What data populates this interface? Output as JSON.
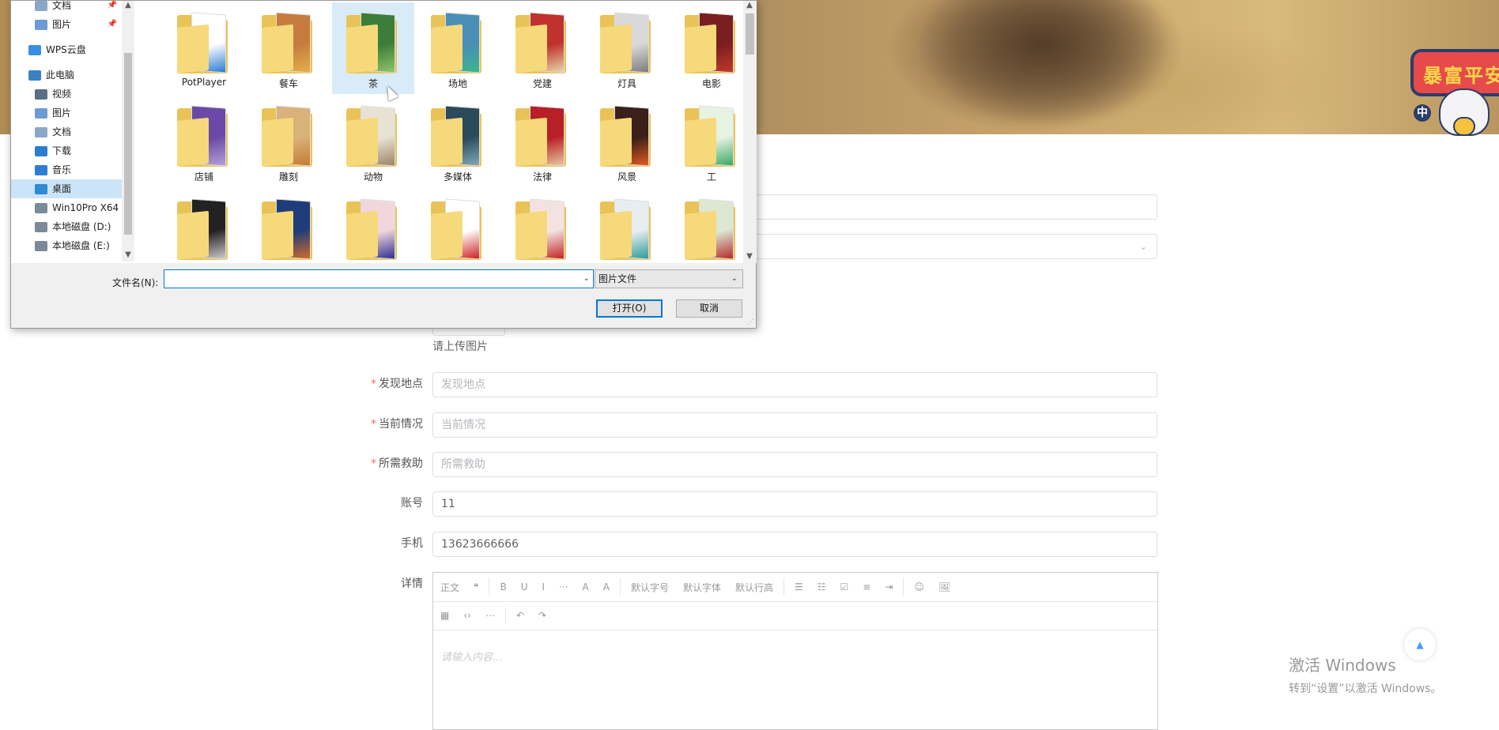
{
  "form": {
    "upload_hint": "请上传图片",
    "location": {
      "label": "发现地点",
      "placeholder": "发现地点"
    },
    "situation": {
      "label": "当前情况",
      "placeholder": "当前情况"
    },
    "help_needed": {
      "label": "所需救助",
      "placeholder": "所需救助"
    },
    "account": {
      "label": "账号",
      "value": "11"
    },
    "phone": {
      "label": "手机",
      "value": "13623666666"
    },
    "detail": {
      "label": "详情"
    },
    "required_mark": "*"
  },
  "banner": {
    "badge_text": "暴富平安",
    "badge_small": "中"
  },
  "editor": {
    "toolbar_row1": [
      "正文",
      "❝",
      "B",
      "U",
      "I",
      "···",
      "A",
      "A",
      "默认字号",
      "默认字体",
      "默认行高",
      "☰",
      "☷",
      "☑",
      "≡",
      "⇥",
      "☺",
      "🖼"
    ],
    "toolbar_row2": [
      "▦",
      "‹›",
      "⋯",
      "↶",
      "↷"
    ],
    "placeholder": "请输入内容..."
  },
  "back_to_top": "▲",
  "watermark": {
    "line1": "激活 Windows",
    "line2": "转到“设置”以激活 Windows。"
  },
  "dialog": {
    "nav_items": [
      {
        "label": "文档",
        "pinned": true,
        "icon": "document-icon",
        "color": "#8aa7c8"
      },
      {
        "label": "图片",
        "pinned": true,
        "icon": "picture-icon",
        "color": "#6e9bd1"
      },
      {
        "label": "WPS云盘",
        "pinned": false,
        "icon": "cloud-icon",
        "color": "#3a8ee6"
      },
      {
        "label": "此电脑",
        "pinned": false,
        "icon": "computer-icon",
        "color": "#3b82c4"
      },
      {
        "label": "视频",
        "pinned": false,
        "icon": "video-icon",
        "color": "#5a6e86"
      },
      {
        "label": "图片",
        "pinned": false,
        "icon": "picture-icon",
        "color": "#6e9bd1"
      },
      {
        "label": "文档",
        "pinned": false,
        "icon": "document-icon",
        "color": "#8aa7c8"
      },
      {
        "label": "下载",
        "pinned": false,
        "icon": "download-icon",
        "color": "#2d7dd2"
      },
      {
        "label": "音乐",
        "pinned": false,
        "icon": "music-icon",
        "color": "#2d7dd2"
      },
      {
        "label": "桌面",
        "pinned": false,
        "icon": "desktop-icon",
        "color": "#2e8bd6",
        "selected": true
      },
      {
        "label": "Win10Pro X64",
        "pinned": false,
        "icon": "drive-icon",
        "color": "#7a8a99"
      },
      {
        "label": "本地磁盘 (D:)",
        "pinned": false,
        "icon": "drive-icon",
        "color": "#7a8a99"
      },
      {
        "label": "本地磁盘 (E:)",
        "pinned": false,
        "icon": "drive-icon",
        "color": "#7a8a99"
      }
    ],
    "folders": [
      {
        "label": "PotPlayer",
        "paper": "#ffffff",
        "accent": "#2a7ad3"
      },
      {
        "label": "餐车",
        "paper": "#c77b3f",
        "accent": "#e3b04b"
      },
      {
        "label": "茶",
        "paper": "#3c7d3a",
        "accent": "#8fc46b",
        "selected": true
      },
      {
        "label": "场地",
        "paper": "#4a8fb6",
        "accent": "#3bb58c"
      },
      {
        "label": "党建",
        "paper": "#c0322d",
        "accent": "#e8d6a8"
      },
      {
        "label": "灯具",
        "paper": "#d9d9d9",
        "accent": "#7b7b7b"
      },
      {
        "label": "电影",
        "paper": "#7a1f1f",
        "accent": "#c0392b"
      },
      {
        "label": "店铺",
        "paper": "#6a4aa6",
        "accent": "#b4a0d8"
      },
      {
        "label": "雕刻",
        "paper": "#d9b27a",
        "accent": "#c57a33"
      },
      {
        "label": "动物",
        "paper": "#e8e2d4",
        "accent": "#9b8466"
      },
      {
        "label": "多媒体",
        "paper": "#2b4a5a",
        "accent": "#7fa9b8"
      },
      {
        "label": "法律",
        "paper": "#b81f26",
        "accent": "#e8c9a0"
      },
      {
        "label": "风景",
        "paper": "#3a1f1a",
        "accent": "#e35a22"
      },
      {
        "label": "工",
        "paper": "#e7f3e2",
        "accent": "#39a863"
      },
      {
        "label": "",
        "paper": "#222222",
        "accent": "#cccccc"
      },
      {
        "label": "",
        "paper": "#1f3d7a",
        "accent": "#d16a2a"
      },
      {
        "label": "",
        "paper": "#f2d6dd",
        "accent": "#2d2d8f"
      },
      {
        "label": "",
        "paper": "#ffffff",
        "accent": "#d02020"
      },
      {
        "label": "",
        "paper": "#f3e3e0",
        "accent": "#c32222"
      },
      {
        "label": "",
        "paper": "#e8eef0",
        "accent": "#2e9b9b"
      },
      {
        "label": "",
        "paper": "#dde7d2",
        "accent": "#b52a2a"
      }
    ],
    "filename_label": "文件名(N):",
    "filename_value": "",
    "filter_value": "图片文件",
    "open_label": "打开(O)",
    "cancel_label": "取消",
    "dropdown_glyph": "⌄"
  }
}
